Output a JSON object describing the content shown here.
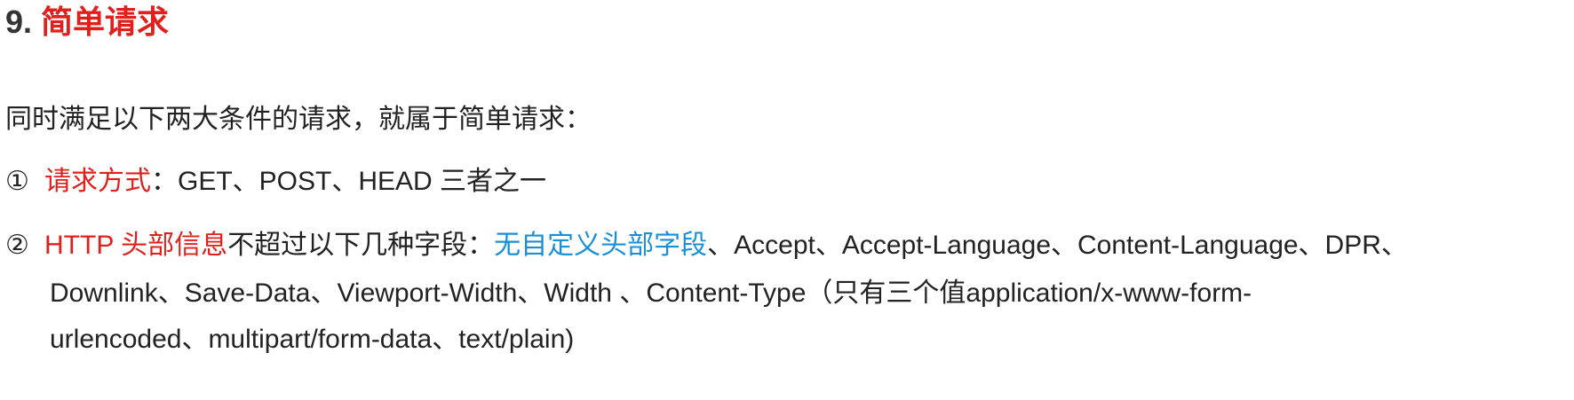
{
  "heading": {
    "number": "9.",
    "title": "简单请求"
  },
  "intro": "同时满足以下两大条件的请求，就属于简单请求：",
  "item1": {
    "marker": "①",
    "highlight": "请求方式",
    "text": "：GET、POST、HEAD 三者之一"
  },
  "item2": {
    "marker": "②",
    "highlight": "HTTP 头部信息",
    "text_a": "不超过以下几种字段：",
    "blue": "无自定义头部字段",
    "text_b": "、Accept、Accept-Language、Content-Language、DPR、",
    "line2": "Downlink、Save-Data、Viewport-Width、Width 、Content-Type（只有三个值application/x-www-form-",
    "line3": "urlencoded、multipart/form-data、text/plain)"
  },
  "colors": {
    "accent_red": "#e0201d",
    "accent_blue": "#1a8fd6",
    "text": "#222222"
  }
}
